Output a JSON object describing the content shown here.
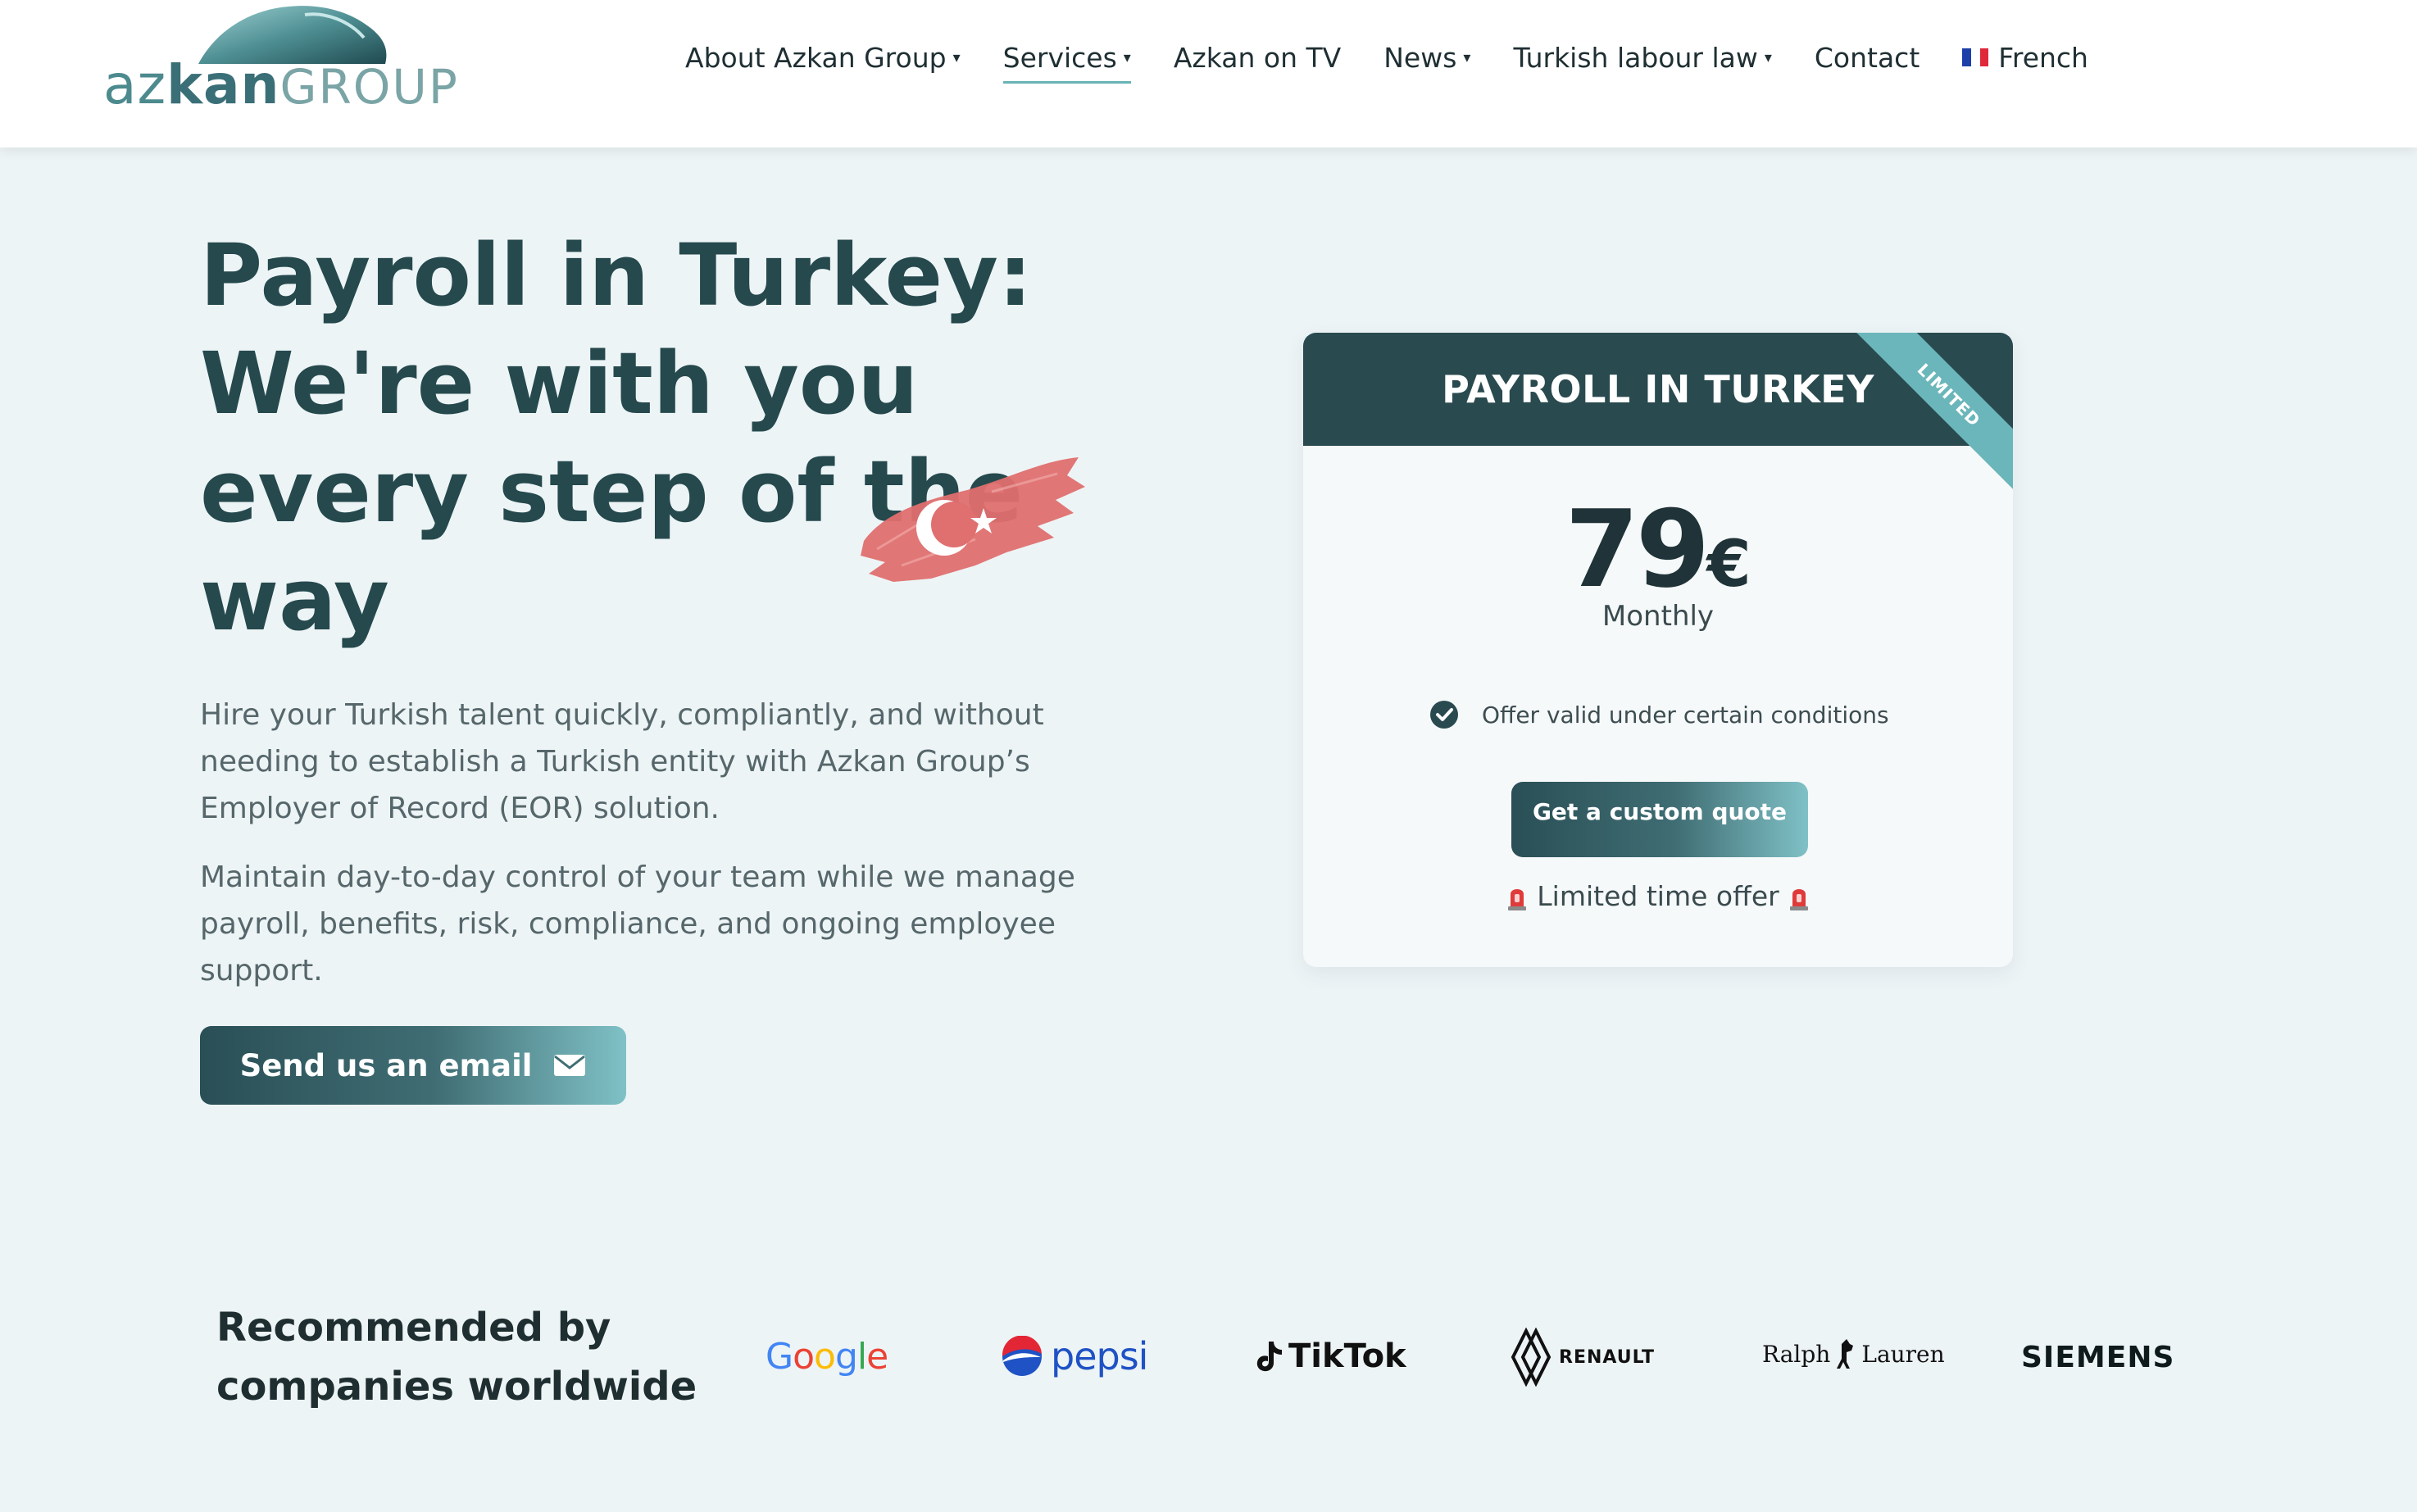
{
  "logo": {
    "part1": "az",
    "part2": "kan",
    "part3": "GROUP"
  },
  "nav": {
    "items": [
      {
        "label": "About Azkan Group",
        "dropdown": true
      },
      {
        "label": "Services",
        "dropdown": true,
        "active": true
      },
      {
        "label": "Azkan on TV",
        "dropdown": false
      },
      {
        "label": "News",
        "dropdown": true
      },
      {
        "label": "Turkish labour law",
        "dropdown": true
      },
      {
        "label": "Contact",
        "dropdown": false
      }
    ],
    "language": "French"
  },
  "hero": {
    "title_lines": [
      "Payroll in Turkey:",
      "We're with you",
      "every step of the",
      "way"
    ],
    "paragraph1": "Hire your Turkish talent quickly, compliantly, and without needing to establish a Turkish entity with Azkan Group’s Employer of Record (EOR) solution.",
    "paragraph2": "Maintain day-to-day control of your team while we manage payroll, benefits, risk, compliance, and ongoing employee support.",
    "email_button": "Send us an email"
  },
  "pricing": {
    "header": "PAYROLL IN TURKEY",
    "ribbon": "LIMITED",
    "price": "79",
    "currency": "€",
    "period": "Monthly",
    "condition": "Offer valid under certain conditions",
    "quote_button": "Get a custom quote",
    "limited_offer": "Limited time offer"
  },
  "recommended": {
    "title": "Recommended by companies worldwide",
    "brands": [
      "Google",
      "pepsi",
      "TikTok",
      "RENAULT",
      "Ralph",
      "Lauren",
      "SIEMENS"
    ]
  },
  "colors": {
    "background": "#edf4f6",
    "primary_dark": "#294a4f",
    "accent": "#6bb6ba",
    "flag_red": "#e05a5a"
  },
  "icons": [
    "caret-down-icon",
    "french-flag-icon",
    "turkish-flag-icon",
    "envelope-icon",
    "check-circle-icon",
    "siren-icon"
  ]
}
